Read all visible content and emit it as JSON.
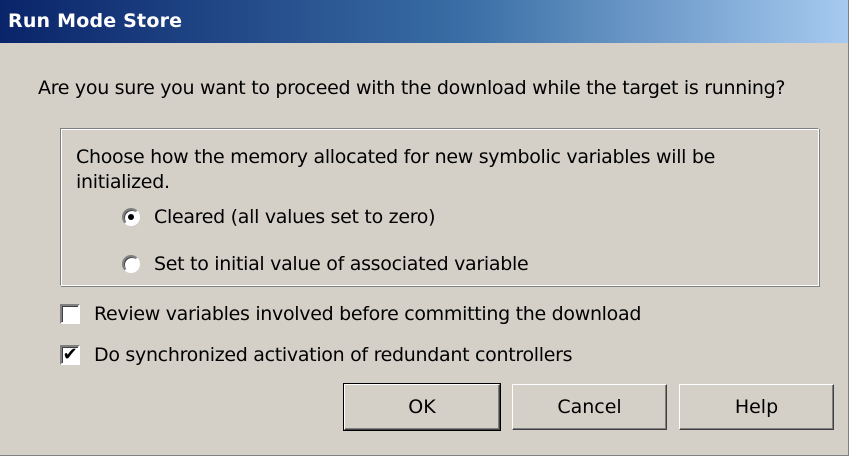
{
  "dialog": {
    "title": "Run Mode Store",
    "prompt": "Are you sure you want to proceed with the download while the target is running?"
  },
  "group": {
    "description": "Choose how the memory allocated for new symbolic variables will be initialized.",
    "options": [
      {
        "label": "Cleared (all values set to zero)",
        "selected": true
      },
      {
        "label": "Set to initial value of associated variable",
        "selected": false
      }
    ]
  },
  "checkboxes": [
    {
      "label": "Review variables involved before committing the download",
      "checked": false
    },
    {
      "label": "Do synchronized activation of redundant controllers",
      "checked": true
    }
  ],
  "buttons": {
    "ok": "OK",
    "cancel": "Cancel",
    "help": "Help"
  }
}
